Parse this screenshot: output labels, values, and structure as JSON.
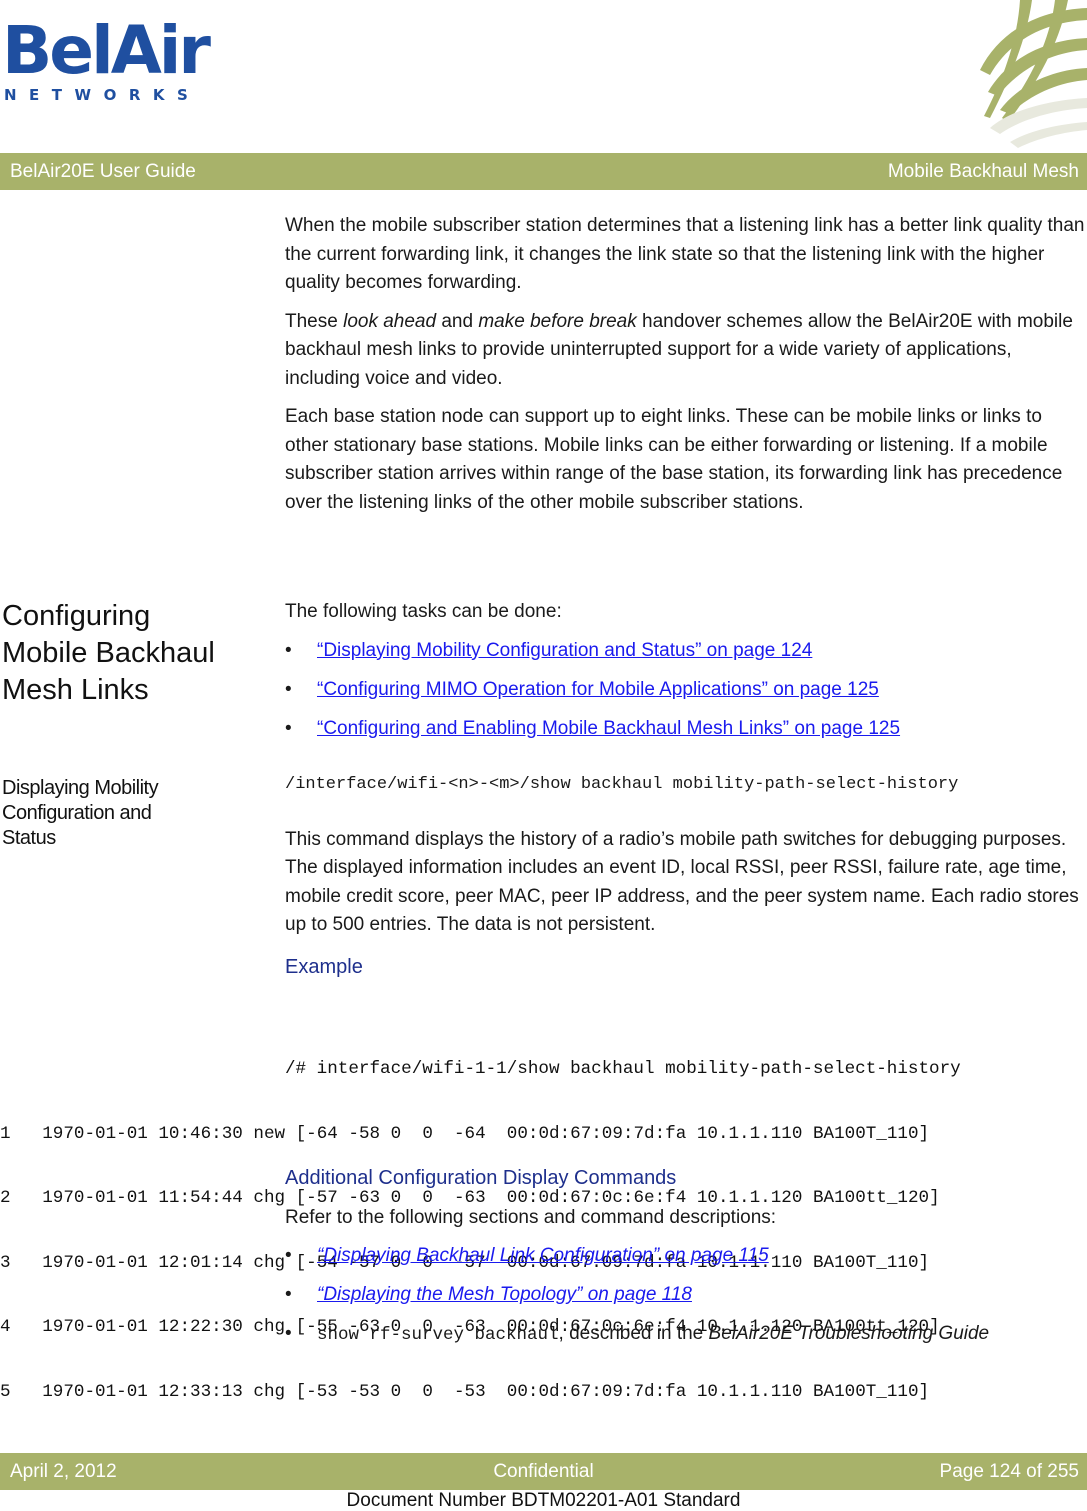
{
  "logo": {
    "wordmark": "BelAir",
    "subtitle": "NETWORKS"
  },
  "header": {
    "left": "BelAir20E User Guide",
    "right": "Mobile Backhaul Mesh"
  },
  "intro_paragraphs": [
    "When the mobile subscriber station determines that a listening link has a better link quality than the current forwarding link, it changes the link state so that the listening link with the higher quality becomes forwarding.",
    "Each base station node can support up to eight links. These can be mobile links or links to other stationary base stations. Mobile links can be either forwarding or listening. If a mobile subscriber station arrives within range of the base station, its forwarding link has precedence over the listening links of the other mobile subscriber stations."
  ],
  "handover_paragraph": {
    "t1": "These ",
    "em1": "look ahead",
    "t2": " and ",
    "em2": "make before break",
    "t3": " handover schemes allow the BelAir20E with mobile backhaul mesh links to provide uninterrupted support for a wide variety of applications, including voice and video."
  },
  "section1": {
    "heading_lines": [
      "Configuring",
      "Mobile Backhaul",
      "Mesh Links"
    ],
    "intro": "The following tasks can be done:",
    "links": [
      "“Displaying Mobility Configuration and Status” on page 124",
      "“Configuring MIMO Operation for Mobile Applications” on page 125",
      "“Configuring and Enabling Mobile Backhaul Mesh Links” on page 125"
    ]
  },
  "section2": {
    "heading_lines": [
      "Displaying Mobility",
      "Configuration and",
      "Status"
    ],
    "command": "/interface/wifi-<n>-<m>/show backhaul mobility-path-select-history",
    "description": "This command displays the history of a radio’s mobile path switches for debugging purposes. The displayed information includes an event ID, local RSSI, peer RSSI, failure rate, age time, mobile credit score, peer MAC, peer IP address, and the peer system name. Each radio stores up to 500 entries. The data is not persistent.",
    "example_label": "Example",
    "example_command": "/# interface/wifi-1-1/show backhaul mobility-path-select-history",
    "example_rows": [
      "1   1970-01-01 10:46:30 new [-64 -58 0  0  -64  00:0d:67:09:7d:fa 10.1.1.110 BA100T_110]",
      "2   1970-01-01 11:54:44 chg [-57 -63 0  0  -63  00:0d:67:0c:6e:f4 10.1.1.120 BA100tt_120]",
      "3   1970-01-01 12:01:14 chg [-54 -57 0  0  -57  00:0d:67:09:7d:fa 10.1.1.110 BA100T_110]",
      "4   1970-01-01 12:22:30 chg [-55 -63 0  0  -63  00:0d:67:0c:6e:f4 10.1.1.120 BA100tt_120]",
      "5   1970-01-01 12:33:13 chg [-53 -53 0  0  -53  00:0d:67:09:7d:fa 10.1.1.110 BA100T_110]"
    ]
  },
  "section3": {
    "heading": "Additional Configuration Display Commands",
    "intro": "Refer to the following sections and command descriptions:",
    "links": [
      "“Displaying Backhaul Link Configuration” on page 115",
      "“Displaying the Mesh Topology” on page 118"
    ],
    "last_item": {
      "code": "show rf-survey backhaul",
      "text": ", described in the ",
      "book": "BelAir20E Troubleshooting Guide"
    }
  },
  "bullet": "•",
  "footer": {
    "date": "April 2, 2012",
    "classification": "Confidential",
    "page": "Page 124 of 255",
    "document_number": "Document Number BDTM02201-A01 Standard"
  },
  "colors": {
    "brand_blue": "#1f4fa0",
    "band_green": "#a8b26a",
    "link_blue": "#1a1aee",
    "subheading_blue": "#1e2f8c"
  }
}
